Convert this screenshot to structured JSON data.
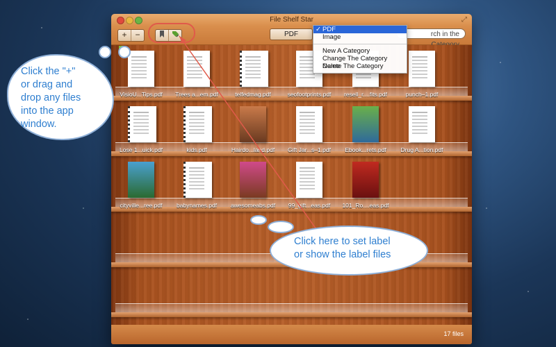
{
  "window": {
    "title": "File Shelf Star",
    "status_count": "17 files"
  },
  "toolbar": {
    "add_label": "+",
    "remove_label": "−",
    "category_select_value": "PDF",
    "search_placeholder": "rch in the Category"
  },
  "dropdown": {
    "items": [
      {
        "label": "PDF",
        "checked": true
      },
      {
        "label": "Image",
        "checked": false
      },
      {
        "label": "New A Category",
        "checked": false
      },
      {
        "label": "Change The Category Name",
        "checked": false
      },
      {
        "label": "Delete The Category",
        "checked": false
      }
    ],
    "check_mark": "✓"
  },
  "shelves": [
    [
      "VisioU...Tips.pdf",
      "Trees a...em.pdf",
      "telfedmag.pdf",
      "seofootprints.pdf",
      "resell_r....fits.pdf",
      "punch–1.pdf"
    ],
    [
      "Lose 1...uick.pdf",
      "kids.pdf",
      "Hairdo...land.pdf",
      "Gift Jar...s–1.pdf",
      "Ebook...rets.pdf",
      "Drug A...tion.pdf"
    ],
    [
      "cityville...ree.pdf",
      "babynames.pdf",
      "awesomeabs.pdf",
      "99_gift...eas.pdf",
      "101_Ro....eas.pdf"
    ]
  ],
  "callouts": {
    "left": [
      "Click the \"+\"",
      "or drag and",
      "drop any files",
      "into the app",
      "window."
    ],
    "bottom": [
      "Click here to set label",
      "or show the label files"
    ]
  },
  "colors": {
    "accent_red": "#e05a4a",
    "callout_text": "#2f7fd0",
    "menu_selected": "#2a66d8"
  }
}
